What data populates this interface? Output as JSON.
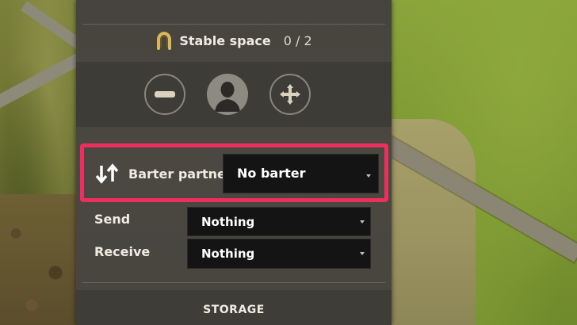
{
  "stable": {
    "label": "Stable space",
    "count": "0 / 2",
    "icon": "horseshoe-icon"
  },
  "controls": {
    "icons": [
      "minus-icon",
      "person-icon",
      "plus-move-icon"
    ]
  },
  "barter": {
    "label": "Barter partner",
    "icon": "swap-arrows-icon",
    "value": "No barter",
    "highlight_color": "#ee2f5e"
  },
  "send": {
    "label": "Send",
    "value": "Nothing"
  },
  "receive": {
    "label": "Receive",
    "value": "Nothing"
  },
  "storage": {
    "title": "STORAGE"
  }
}
